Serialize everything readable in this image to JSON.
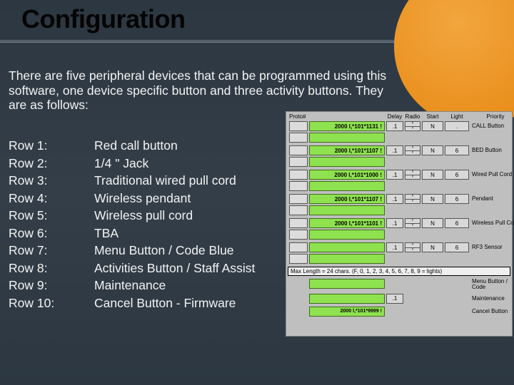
{
  "title": "Configuration",
  "intro": "There are five peripheral devices that can be programmed using this software, one device specific button and three activity buttons. They are as follows:",
  "rows": [
    {
      "label": "Row 1:",
      "desc": "Red call button"
    },
    {
      "label": "Row 2:",
      "desc": "1/4 \" Jack"
    },
    {
      "label": "Row 3:",
      "desc": "Traditional wired pull cord"
    },
    {
      "label": "Row 4:",
      "desc": "Wireless pendant"
    },
    {
      "label": "Row 5:",
      "desc": "Wireless pull cord"
    },
    {
      "label": "Row 6:",
      "desc": "TBA"
    },
    {
      "label": "Row 7:",
      "desc": "Menu Button / Code Blue"
    },
    {
      "label": "Row 8:",
      "desc": "Activities Button / Staff Assist"
    },
    {
      "label": "Row 9:",
      "desc": "Maintenance"
    },
    {
      "label": "Row 10:",
      "desc": " Cancel Button - Firmware"
    }
  ],
  "panel": {
    "headers": {
      "proto": "Proto#",
      "delay": "Delay",
      "radio": "Radio",
      "start": "Start",
      "light": "Light",
      "priority": "Priority"
    },
    "rowItems": [
      {
        "bar": "2000 l,*101*1131 !",
        "delay": ".1",
        "radio": "N",
        "priority": ".",
        "label": "CALL Button"
      },
      {
        "bar": "2000 l,*101*1107 !",
        "delay": ".1",
        "radio": "N",
        "priority": "6",
        "label": "BED Button"
      },
      {
        "bar": "2000 l,*101*1000 !",
        "delay": ".1",
        "radio": "N",
        "priority": "6",
        "label": "Wired Pull Cord"
      },
      {
        "bar": "2000 l,*101*1107 !",
        "delay": ".1",
        "radio": "N",
        "priority": "6",
        "label": "Pendant"
      },
      {
        "bar": "2000 l,*101*1101 !",
        "delay": ".1",
        "radio": "N",
        "priority": "6",
        "label": "Wireless Pull Cord"
      },
      {
        "bar": "",
        "delay": ".1",
        "radio": "N",
        "priority": "6",
        "label": "RF3 Sensor"
      }
    ],
    "maxlenText": "Max Length = 24 chars.  (F, 0, 1, 2, 3, 4, 5, 6, 7, 8, 9 = lights)",
    "footerRows": [
      {
        "label": "Menu Button / Code"
      },
      {
        "label": "Maintenance"
      },
      {
        "label": "Cancel Button"
      }
    ],
    "footerBar": "2000 l,*101*9999 !",
    "footerCell": ".1"
  },
  "colors": {
    "accent": "#e98f1d",
    "green": "#8fe24f"
  }
}
